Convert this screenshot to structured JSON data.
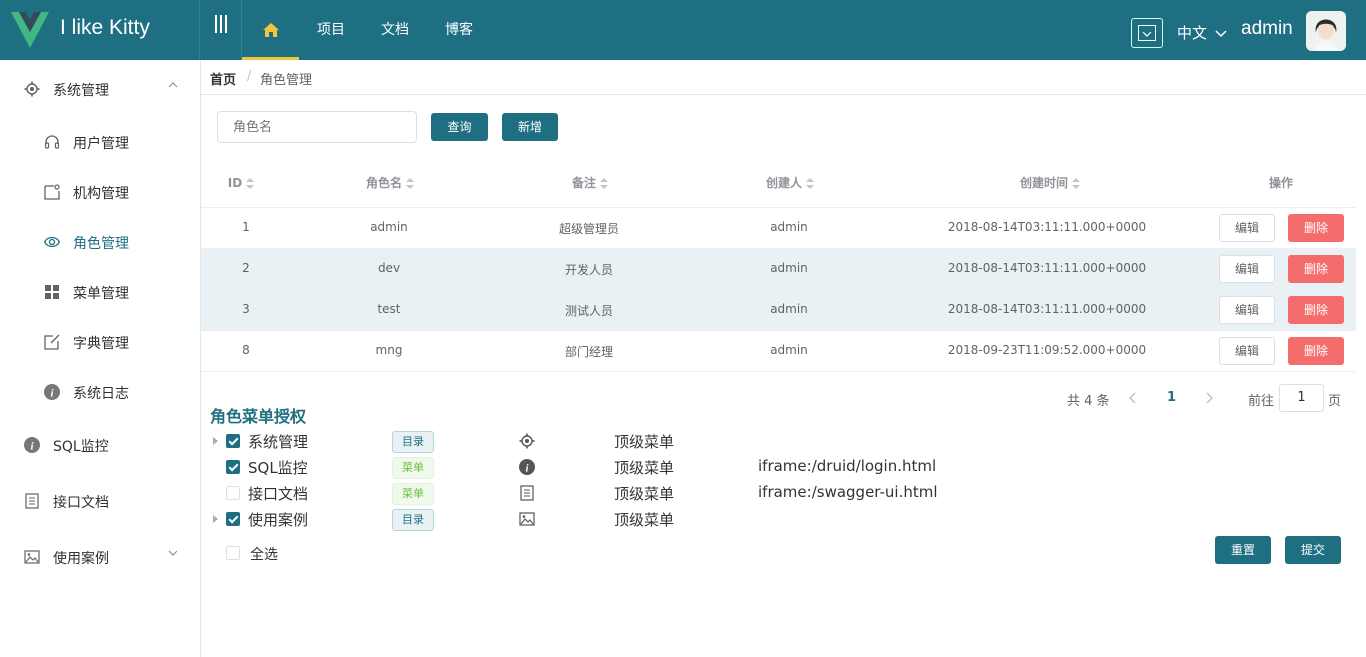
{
  "header": {
    "brand": "I like Kitty",
    "nav": [
      "项目",
      "文档",
      "博客"
    ],
    "lang": "中文",
    "username": "admin"
  },
  "sidebar": {
    "items": [
      {
        "label": "系统管理",
        "icon": "gear-icon"
      },
      {
        "label": "用户管理",
        "icon": "headset-icon"
      },
      {
        "label": "机构管理",
        "icon": "org-icon"
      },
      {
        "label": "角色管理",
        "icon": "eye-icon"
      },
      {
        "label": "菜单管理",
        "icon": "grid-icon"
      },
      {
        "label": "字典管理",
        "icon": "edit-icon"
      },
      {
        "label": "系统日志",
        "icon": "info-icon"
      },
      {
        "label": "SQL监控",
        "icon": "info-icon"
      },
      {
        "label": "接口文档",
        "icon": "document-icon"
      },
      {
        "label": "使用案例",
        "icon": "image-icon"
      }
    ]
  },
  "breadcrumb": {
    "home": "首页",
    "separator": "/",
    "current": "角色管理"
  },
  "toolbar": {
    "search_placeholder": "角色名",
    "query": "查询",
    "add": "新增"
  },
  "table": {
    "headers": [
      "ID",
      "角色名",
      "备注",
      "创建人",
      "创建时间",
      "操作"
    ],
    "rows": [
      {
        "id": "1",
        "name": "admin",
        "remark": "超级管理员",
        "creator": "admin",
        "time": "2018-08-14T03:11:11.000+0000"
      },
      {
        "id": "2",
        "name": "dev",
        "remark": "开发人员",
        "creator": "admin",
        "time": "2018-08-14T03:11:11.000+0000"
      },
      {
        "id": "3",
        "name": "test",
        "remark": "测试人员",
        "creator": "admin",
        "time": "2018-08-14T03:11:11.000+0000"
      },
      {
        "id": "8",
        "name": "mng",
        "remark": "部门经理",
        "creator": "admin",
        "time": "2018-09-23T11:09:52.000+0000"
      }
    ],
    "edit_label": "编辑",
    "delete_label": "删除"
  },
  "pagination": {
    "total": "共 4 条",
    "current": "1",
    "goto": "前往",
    "page_unit": "页",
    "page_input": "1"
  },
  "auth": {
    "title": "角色菜单授权",
    "rows": [
      {
        "name": "系统管理",
        "type": "目录",
        "parent": "顶级菜单",
        "url": "",
        "checked": true,
        "expandable": true
      },
      {
        "name": "SQL监控",
        "type": "菜单",
        "parent": "顶级菜单",
        "url": "iframe:/druid/login.html",
        "checked": true,
        "expandable": false
      },
      {
        "name": "接口文档",
        "type": "菜单",
        "parent": "顶级菜单",
        "url": "iframe:/swagger-ui.html",
        "checked": false,
        "expandable": false
      },
      {
        "name": "使用案例",
        "type": "目录",
        "parent": "顶级菜单",
        "url": "",
        "checked": true,
        "expandable": true
      }
    ],
    "select_all": "全选",
    "reset": "重置",
    "submit": "提交"
  },
  "colors": {
    "primary": "#1f6f83",
    "danger": "#f56c6c",
    "accent": "#f0c43c"
  }
}
